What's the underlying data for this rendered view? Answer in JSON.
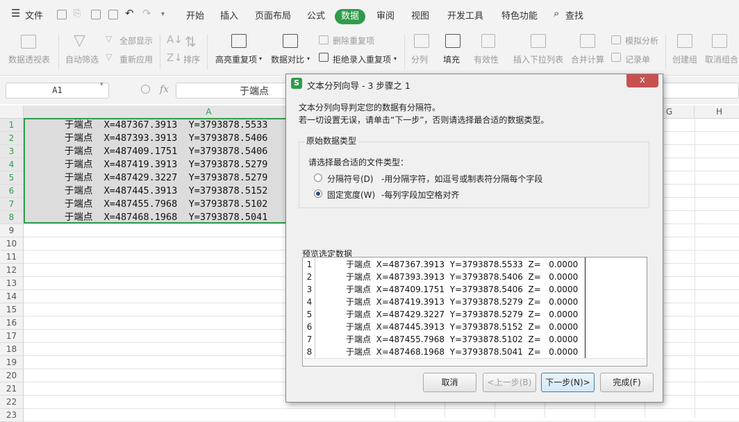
{
  "menubar": {
    "file": "文件",
    "tabs": [
      "开始",
      "插入",
      "页面布局",
      "公式",
      "数据",
      "审阅",
      "视图",
      "开发工具",
      "特色功能"
    ],
    "active_tab": "数据",
    "search": "查找",
    "accent": "#2f9c4a"
  },
  "ribbon": {
    "pivot": "数据透视表",
    "auto_filter": "自动筛选",
    "show_all": "全部显示",
    "reapply": "重新应用",
    "sort": "排序",
    "highlight_dup": "高亮重复项",
    "data_compare": "数据对比",
    "remove_dup": "删除重复项",
    "reject_dup": "拒绝录入重复项",
    "split": "分列",
    "fill": "填充",
    "validity": "有效性",
    "insert_dropdown": "插入下拉列表",
    "merge_calc": "合并计算",
    "simulate": "模拟分析",
    "record": "记录单",
    "create_group": "创建组",
    "ungroup": "取消组合"
  },
  "formula": {
    "cell_ref": "A1",
    "fx": "fx",
    "value": "于端点"
  },
  "sheet": {
    "columns": [
      "A",
      "G",
      "H"
    ],
    "rows": [
      "1",
      "2",
      "3",
      "4",
      "5",
      "6",
      "7",
      "8",
      "9",
      "10",
      "11",
      "12",
      "13",
      "14",
      "15",
      "16",
      "17",
      "18",
      "19",
      "20",
      "21",
      "22",
      "23"
    ],
    "cells": [
      "       于端点  X=487367.3913  Y=3793878.5533",
      "       于端点  X=487393.3913  Y=3793878.5406",
      "       于端点  X=487409.1751  Y=3793878.5406",
      "       于端点  X=487419.3913  Y=3793878.5279",
      "       于端点  X=487429.3227  Y=3793878.5279",
      "       于端点  X=487445.3913  Y=3793878.5152",
      "       于端点  X=487455.7968  Y=3793878.5102",
      "       于端点  X=487468.1968  Y=3793878.5041"
    ]
  },
  "dialog": {
    "title": "文本分列向导 - 3 步骤之 1",
    "close": "x",
    "desc1": "文本分列向导判定您的数据有分隔符。",
    "desc2": "若一切设置无误，请单击“下一步”，否则请选择最合适的数据类型。",
    "group_title": "原始数据类型",
    "prompt": "请选择最合适的文件类型：",
    "opt_delim": "分隔符号(D)",
    "opt_delim_desc": "-用分隔字符，如逗号或制表符分隔每个字段",
    "opt_fixed": "固定宽度(W)",
    "opt_fixed_desc": "-每列字段加空格对齐",
    "selected": "fixed",
    "preview_title": "预览选定数据",
    "preview_rows": [
      {
        "n": "1",
        "t": "于端点  X=487367.3913  Y=3793878.5533  Z=   0.0000"
      },
      {
        "n": "2",
        "t": "于端点  X=487393.3913  Y=3793878.5406  Z=   0.0000"
      },
      {
        "n": "3",
        "t": "于端点  X=487409.1751  Y=3793878.5406  Z=   0.0000"
      },
      {
        "n": "4",
        "t": "于端点  X=487419.3913  Y=3793878.5279  Z=   0.0000"
      },
      {
        "n": "5",
        "t": "于端点  X=487429.3227  Y=3793878.5279  Z=   0.0000"
      },
      {
        "n": "6",
        "t": "于端点  X=487445.3913  Y=3793878.5152  Z=   0.0000"
      },
      {
        "n": "7",
        "t": "于端点  X=487455.7968  Y=3793878.5102  Z=   0.0000"
      },
      {
        "n": "8",
        "t": "于端点  X=487468.1968  Y=3793878.5041  Z=   0.0000"
      }
    ],
    "btn_cancel": "取消",
    "btn_prev": "<上一步(B)",
    "btn_next": "下一步(N)>",
    "btn_finish": "完成(F)"
  }
}
